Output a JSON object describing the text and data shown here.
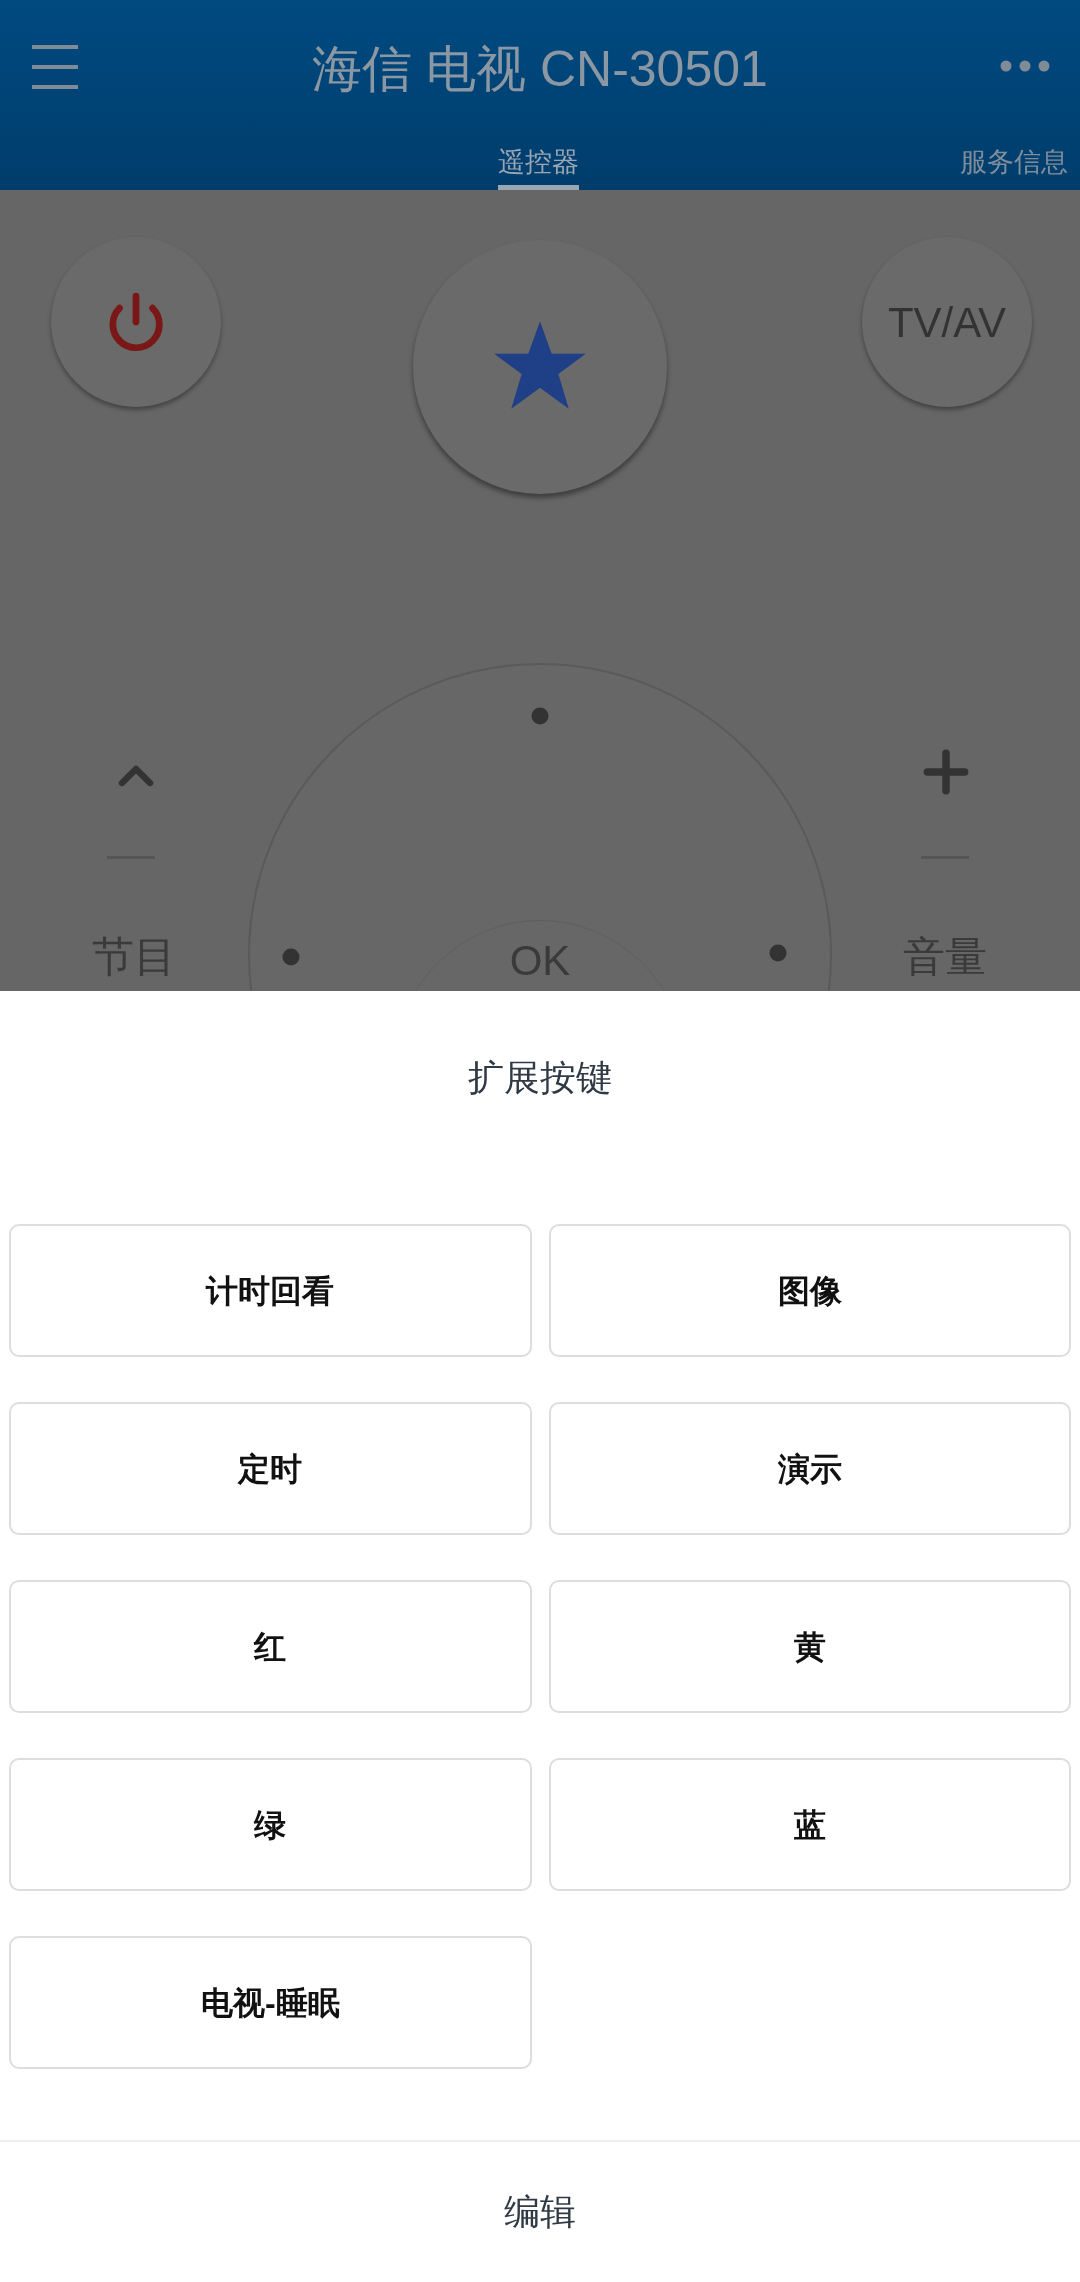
{
  "header": {
    "title": "海信 电视 CN-30501"
  },
  "tabs": [
    {
      "label": "遥控器",
      "selected": true
    },
    {
      "label": "服务信息",
      "selected": false
    }
  ],
  "remote": {
    "tv_av": "TV/AV",
    "ok": "OK",
    "channel_label": "节目",
    "volume_label": "音量"
  },
  "sheet": {
    "title": "扩展按键",
    "buttons": [
      "计时回看",
      "图像",
      "定时",
      "演示",
      "红",
      "黄",
      "绿",
      "蓝",
      "电视-睡眠"
    ],
    "footer": "编辑"
  }
}
